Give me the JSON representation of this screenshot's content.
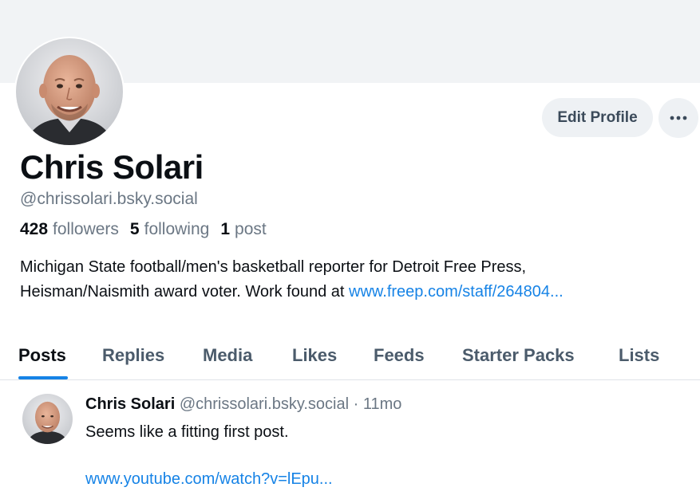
{
  "profile": {
    "name": "Chris Solari",
    "handle": "@chrissolari.bsky.social",
    "avatar": "profile-photo",
    "edit_label": "Edit Profile",
    "more_icon": "more-horizontal-icon",
    "stats": {
      "followers_count": "428",
      "followers_label": "followers",
      "following_count": "5",
      "following_label": "following",
      "posts_count": "1",
      "posts_label": "post"
    },
    "bio_line1": "Michigan State football/men's basketball reporter for Detroit Free Press,",
    "bio_line2": "Heisman/Naismith award voter. Work found at ",
    "bio_link": "www.freep.com/staff/264804..."
  },
  "tabs": [
    {
      "label": "Posts",
      "active": true
    },
    {
      "label": "Replies"
    },
    {
      "label": "Media"
    },
    {
      "label": "Likes"
    },
    {
      "label": "Feeds"
    },
    {
      "label": "Starter Packs"
    },
    {
      "label": "Lists"
    }
  ],
  "post": {
    "author": "Chris Solari",
    "handle": "@chrissolari.bsky.social",
    "separator": "·",
    "time": "11mo",
    "text": "Seems like a fitting first post.",
    "link": "www.youtube.com/watch?v=lEpu..."
  },
  "colors": {
    "accent": "#1683e6",
    "banner": "#f1f3f5",
    "muted_text": "#6b7784"
  }
}
